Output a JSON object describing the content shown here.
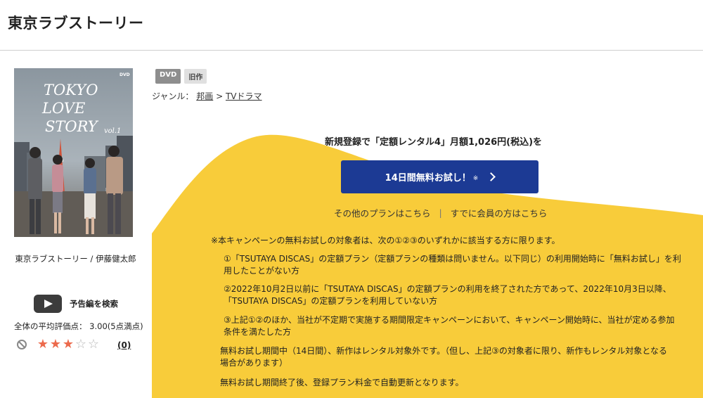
{
  "page": {
    "title": "東京ラブストーリー"
  },
  "cover": {
    "title_art_lines": [
      "TOKYO",
      "LOVE",
      "STORY"
    ],
    "volume": "vol.1",
    "format_mark": "DVD"
  },
  "product": {
    "caption": "東京ラブストーリー / 伊藤健太郎"
  },
  "trailer": {
    "label": "予告編を検索",
    "icon": "play-icon"
  },
  "rating": {
    "average_text": "全体の平均評価点：  3.00(5点満点)",
    "stars_filled": 3,
    "stars_total": 5,
    "review_count": "(0)"
  },
  "badges": {
    "format": "DVD",
    "age": "旧作"
  },
  "genre": {
    "prefix": "ジャンル：",
    "crumbs": [
      "邦画",
      "TVドラマ"
    ],
    "separator": ">"
  },
  "promo": {
    "heading": "新規登録で「定額レンタル4」月額1,026円(税込)を",
    "button_label": "14日間無料お試し！",
    "button_note": "※",
    "other_plans": "その他のプランはこちら",
    "link_separator": "|",
    "members": "すでに会員の方はこちら"
  },
  "terms": {
    "intro": "※本キャンペーンの無料お試しの対象者は、次の①②③のいずれかに該当する方に限ります。",
    "item1_a": "①「TSUTAYA DISCAS」の定額プラン（定額プランの種類は問いません。以下同じ）の利用開始時に「無料お試し」を利",
    "item1_b": "用したことがない方",
    "item2_a": "②2022年10月2日以前に「TSUTAYA DISCAS」の定額プランの利用を終了された方であって、2022年10月3日以降、",
    "item2_b": "「TSUTAYA DISCAS」の定額プランを利用していない方",
    "item3_a": "③上記①②のほか、当社が不定期で実施する期間限定キャンペーンにおいて、キャンペーン開始時に、当社が定める参加",
    "item3_b": "条件を満たした方",
    "note1_a": "無料お試し期間中（14日間）、新作はレンタル対象外です。（但し、上記③の対象者に限り、新作もレンタル対象となる",
    "note1_b": "場合があります）",
    "note2": "無料お試し期間終了後、登録プラン料金で自動更新となります。"
  },
  "colors": {
    "accent_yellow": "#f8cc3a",
    "button_blue": "#1c3a94",
    "star": "#ec6a4c"
  }
}
